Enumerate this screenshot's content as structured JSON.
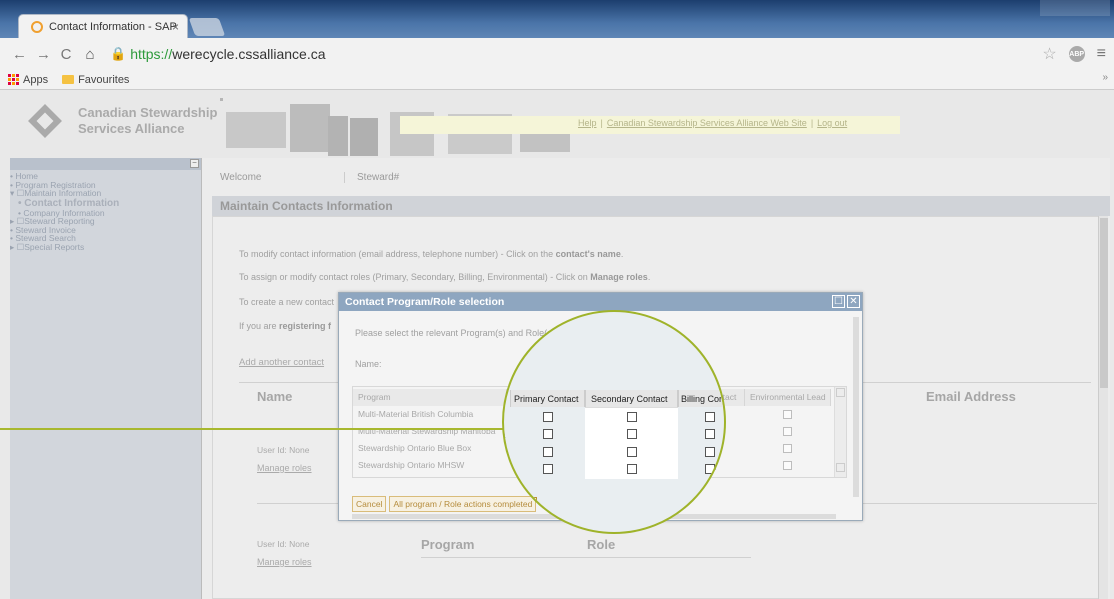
{
  "browser": {
    "tab_title": "Contact Information - SAP",
    "tab_close": "×",
    "url_scheme": "https://",
    "url_host": "werecycle.cssalliance.ca",
    "bookmarks": [
      {
        "label": "Apps",
        "icon": "apps-icon"
      },
      {
        "label": "Favourites",
        "icon": "folder-icon"
      }
    ],
    "more": "»"
  },
  "header": {
    "logo_line1": "Canadian Stewardship",
    "logo_line2": "Services Alliance",
    "links": [
      "Help",
      "Canadian Stewardship Services Alliance Web Site",
      "Log out"
    ]
  },
  "sidebar": {
    "items": [
      {
        "label": "• Home"
      },
      {
        "label": "• Program Registration"
      },
      {
        "label": "▾ ☐Maintain Information"
      },
      {
        "label": "• Contact Information",
        "active": true
      },
      {
        "label": "• Company Information"
      },
      {
        "label": "▸ ☐Steward Reporting"
      },
      {
        "label": "• Steward Invoice"
      },
      {
        "label": "• Steward Search"
      },
      {
        "label": "▸ ☐Special Reports"
      }
    ]
  },
  "main": {
    "welcome": "Welcome",
    "steward": "Steward#",
    "section_title": "Maintain Contacts Information",
    "instructions": {
      "line1_pre": "To modify contact information (email address, telephone number) - Click on the ",
      "line1_bold": "contact's name",
      "line2_pre": "To assign or modify contact roles (Primary, Secondary, Billing, Environmental) - Click on ",
      "line2_bold": "Manage roles",
      "line3_pre": "To create a new contact",
      "line4_pre": "If you are ",
      "line4_bold": "registering f"
    },
    "add_contact": "Add another contact",
    "col_name": "Name",
    "col_email": "Email Address",
    "col_program": "Program",
    "col_role": "Role",
    "rows": [
      {
        "user_id": "User Id: None",
        "manage": "Manage roles"
      },
      {
        "user_id": "User Id: None",
        "manage": "Manage roles"
      }
    ]
  },
  "modal": {
    "title": "Contact Program/Role selection",
    "btn_max": "☐",
    "btn_close": "✕",
    "prompt": "Please select the relevant Program(s) and Role(s).",
    "name_label": "Name:",
    "headers": [
      "Program",
      "Primary Contact",
      "Secondary Contact",
      "Billing Contact",
      "Environmental Lead"
    ],
    "programs": [
      "Multi-Material British Columbia",
      "Multi-Material Stewardship Manitoba",
      "Stewardship Ontario Blue Box",
      "Stewardship Ontario MHSW"
    ],
    "cancel": "Cancel",
    "complete": "All program / Role actions completed"
  },
  "accent_color": "#9fb32a"
}
